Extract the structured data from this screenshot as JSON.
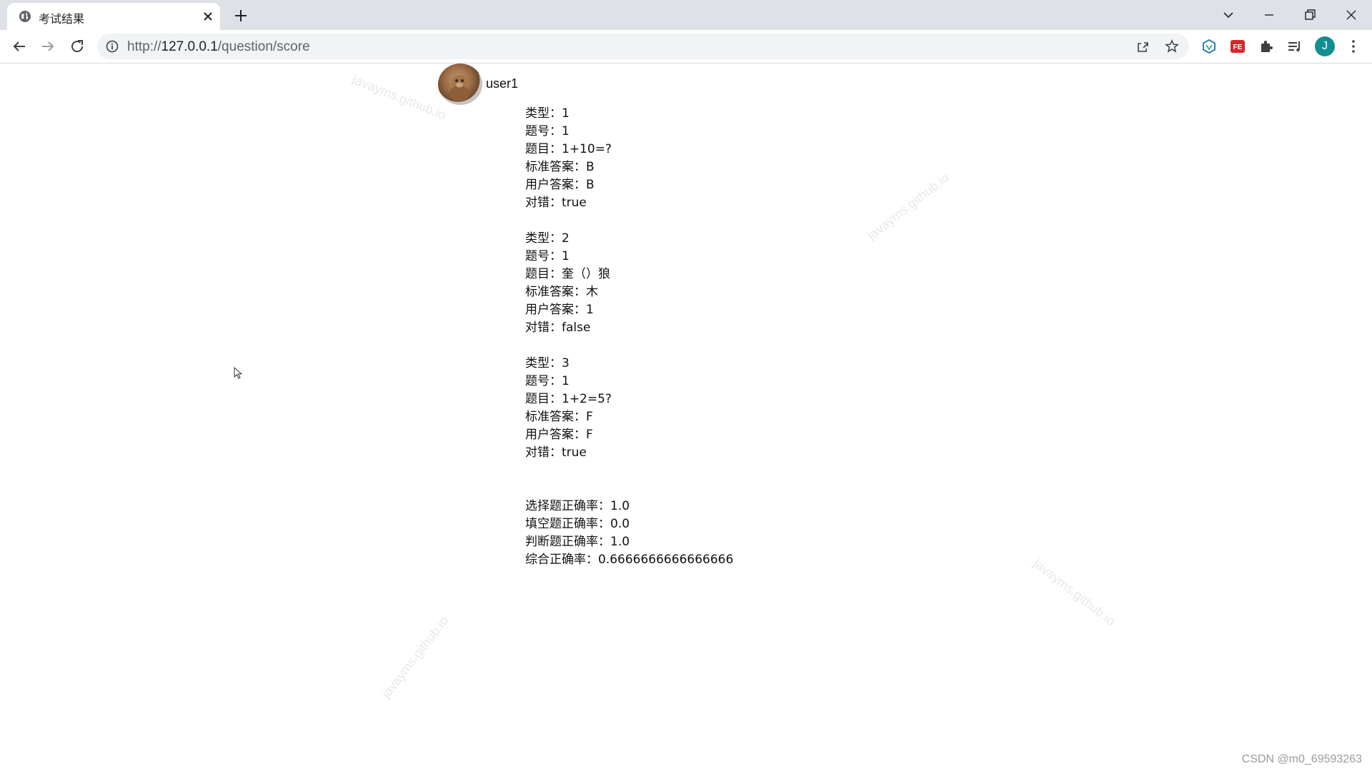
{
  "browser": {
    "tab_title": "考试结果",
    "url_scheme": "http://",
    "url_host": "127.0.0.1",
    "url_path": "/question/score",
    "profile_initial": "J"
  },
  "icons": {
    "favicon": "globe-icon",
    "close": "close-icon",
    "new_tab": "plus-icon",
    "back": "back-arrow-icon",
    "forward": "forward-arrow-icon",
    "reload": "reload-icon",
    "info": "info-icon",
    "share": "share-icon",
    "bookmark": "star-icon",
    "extensions": [
      "vue-devtools-icon",
      "fe-helper-icon",
      "puzzle-icon",
      "reading-list-icon"
    ],
    "menu": "kebab-menu-icon"
  },
  "header": {
    "username": "user1"
  },
  "records": [
    {
      "type_label": "类型：",
      "type": "1",
      "no_label": "题号：",
      "no": "1",
      "question_label": "题目：",
      "question": "1+10=?",
      "standard_label": "标准答案：",
      "standard": "B",
      "user_label": "用户答案：",
      "user": "B",
      "result_label": "对错：",
      "result": "true"
    },
    {
      "type_label": "类型：",
      "type": "2",
      "no_label": "题号：",
      "no": "1",
      "question_label": "题目：",
      "question": "奎（）狼",
      "standard_label": "标准答案：",
      "standard": "木",
      "user_label": "用户答案：",
      "user": "1",
      "result_label": "对错：",
      "result": "false"
    },
    {
      "type_label": "类型：",
      "type": "3",
      "no_label": "题号：",
      "no": "1",
      "question_label": "题目：",
      "question": "1+2=5?",
      "standard_label": "标准答案：",
      "standard": "F",
      "user_label": "用户答案：",
      "user": "F",
      "result_label": "对错：",
      "result": "true"
    }
  ],
  "stats": [
    {
      "label": "选择题正确率：",
      "value": "1.0"
    },
    {
      "label": "填空题正确率：",
      "value": "0.0"
    },
    {
      "label": "判断题正确率：",
      "value": "1.0"
    },
    {
      "label": "综合正确率：",
      "value": "0.6666666666666666"
    }
  ],
  "watermark": "javayms.github.io",
  "footer": "CSDN @m0_69593263"
}
